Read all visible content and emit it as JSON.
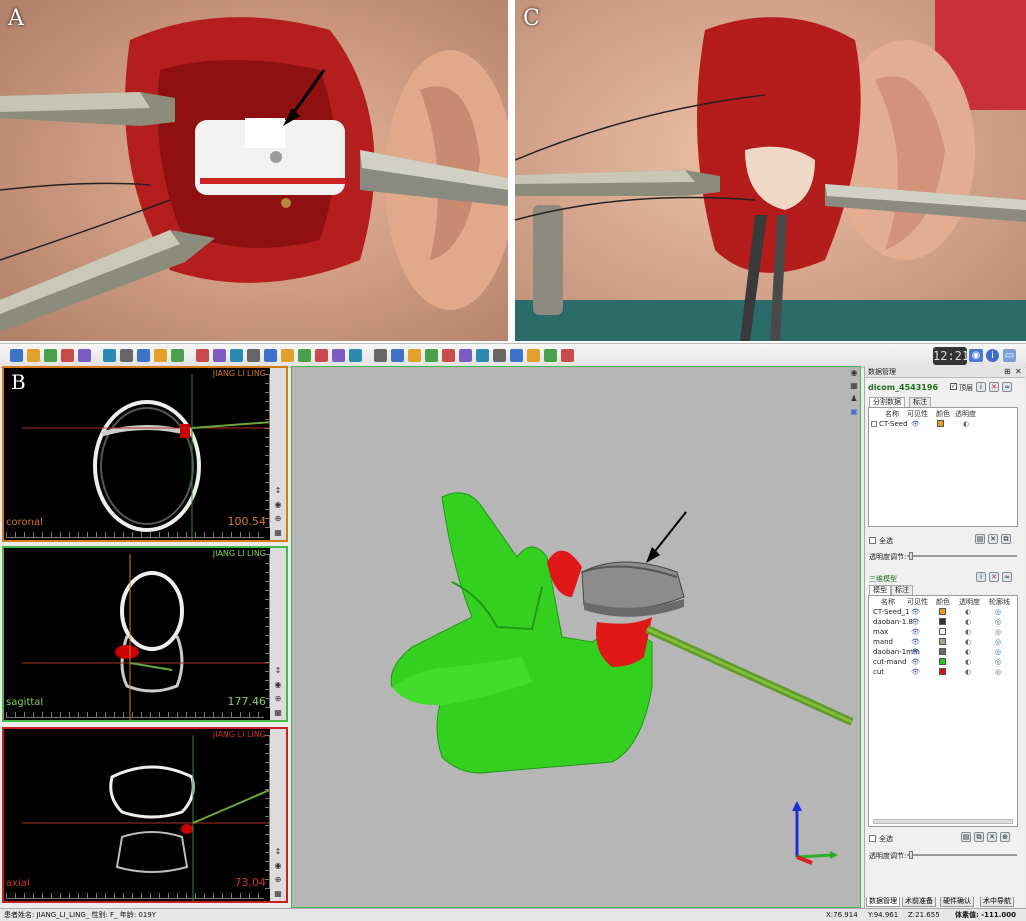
{
  "photos": {
    "a_label": "A",
    "c_label": "C",
    "b_label": "B"
  },
  "toolbar": {
    "clock": "12:21",
    "icon_names": [
      "new-icon",
      "open-icon",
      "save-icon",
      "save-as-icon",
      "export-icon",
      "layout-icon",
      "crosshair-icon",
      "eye-icon",
      "zoom-in-icon",
      "zoom-out-icon",
      "ruler-icon",
      "angle-icon",
      "lasso-icon",
      "pipette-icon",
      "paint-icon",
      "screenshot-icon",
      "camera-icon",
      "plus-9-icon",
      "brush-icon",
      "cut-icon",
      "cube-icon",
      "wand-icon",
      "grid-icon",
      "mesh-icon",
      "head-icon",
      "model-icon",
      "split-icon",
      "graph-icon",
      "pen-icon",
      "light-icon",
      "sphere-icon",
      "dome-icon"
    ]
  },
  "viewports": {
    "coronal": {
      "name": "coronal",
      "value": "100.54",
      "patient": "JIANG LI LING"
    },
    "sagittal": {
      "name": "sagittal",
      "value": "177.46",
      "patient": "JIANG LI LING"
    },
    "axial": {
      "name": "axial",
      "value": "73.04",
      "patient": "JIANG LI LING"
    }
  },
  "panel": {
    "title": "数据管理",
    "dicom": "dicom_4543196",
    "top_label": "顶层",
    "seg_tab": "分割数据",
    "mark_tab": "标注",
    "col_name": "名称",
    "col_visible": "可见性",
    "col_color": "颜色",
    "col_opacity": "透明度",
    "col_contour": "轮廓线",
    "seg_rows": [
      {
        "name": "CT-Seed",
        "color": "#e89a1c"
      }
    ],
    "select_all": "全选",
    "opacity_adjust": "透明度调节:",
    "model_section": "三维模型",
    "model_tab": "模型",
    "model_mark_tab": "标注",
    "model_rows": [
      {
        "name": "CT-Seed_1",
        "color": "#e89a1c"
      },
      {
        "name": "daoban-1.8",
        "color": "#333344"
      },
      {
        "name": "max",
        "color": "#f2f2f2"
      },
      {
        "name": "mand",
        "color": "#9aa88f"
      },
      {
        "name": "daoban-1mm",
        "color": "#6a6a6a"
      },
      {
        "name": "cut-mand",
        "color": "#22cc22"
      },
      {
        "name": "cut",
        "color": "#dd1111"
      }
    ],
    "bottom_tabs": [
      "数据管理",
      "术前准备",
      "硬件确认",
      "术中导航"
    ]
  },
  "status": {
    "patient": "患者姓名: JIANG_LI_LING_ 性别: F_ 年龄: 019Y",
    "x": "X:76.914",
    "y": "Y:94.961",
    "z": "Z:21.655",
    "voxel": "体素值: -111.000"
  }
}
